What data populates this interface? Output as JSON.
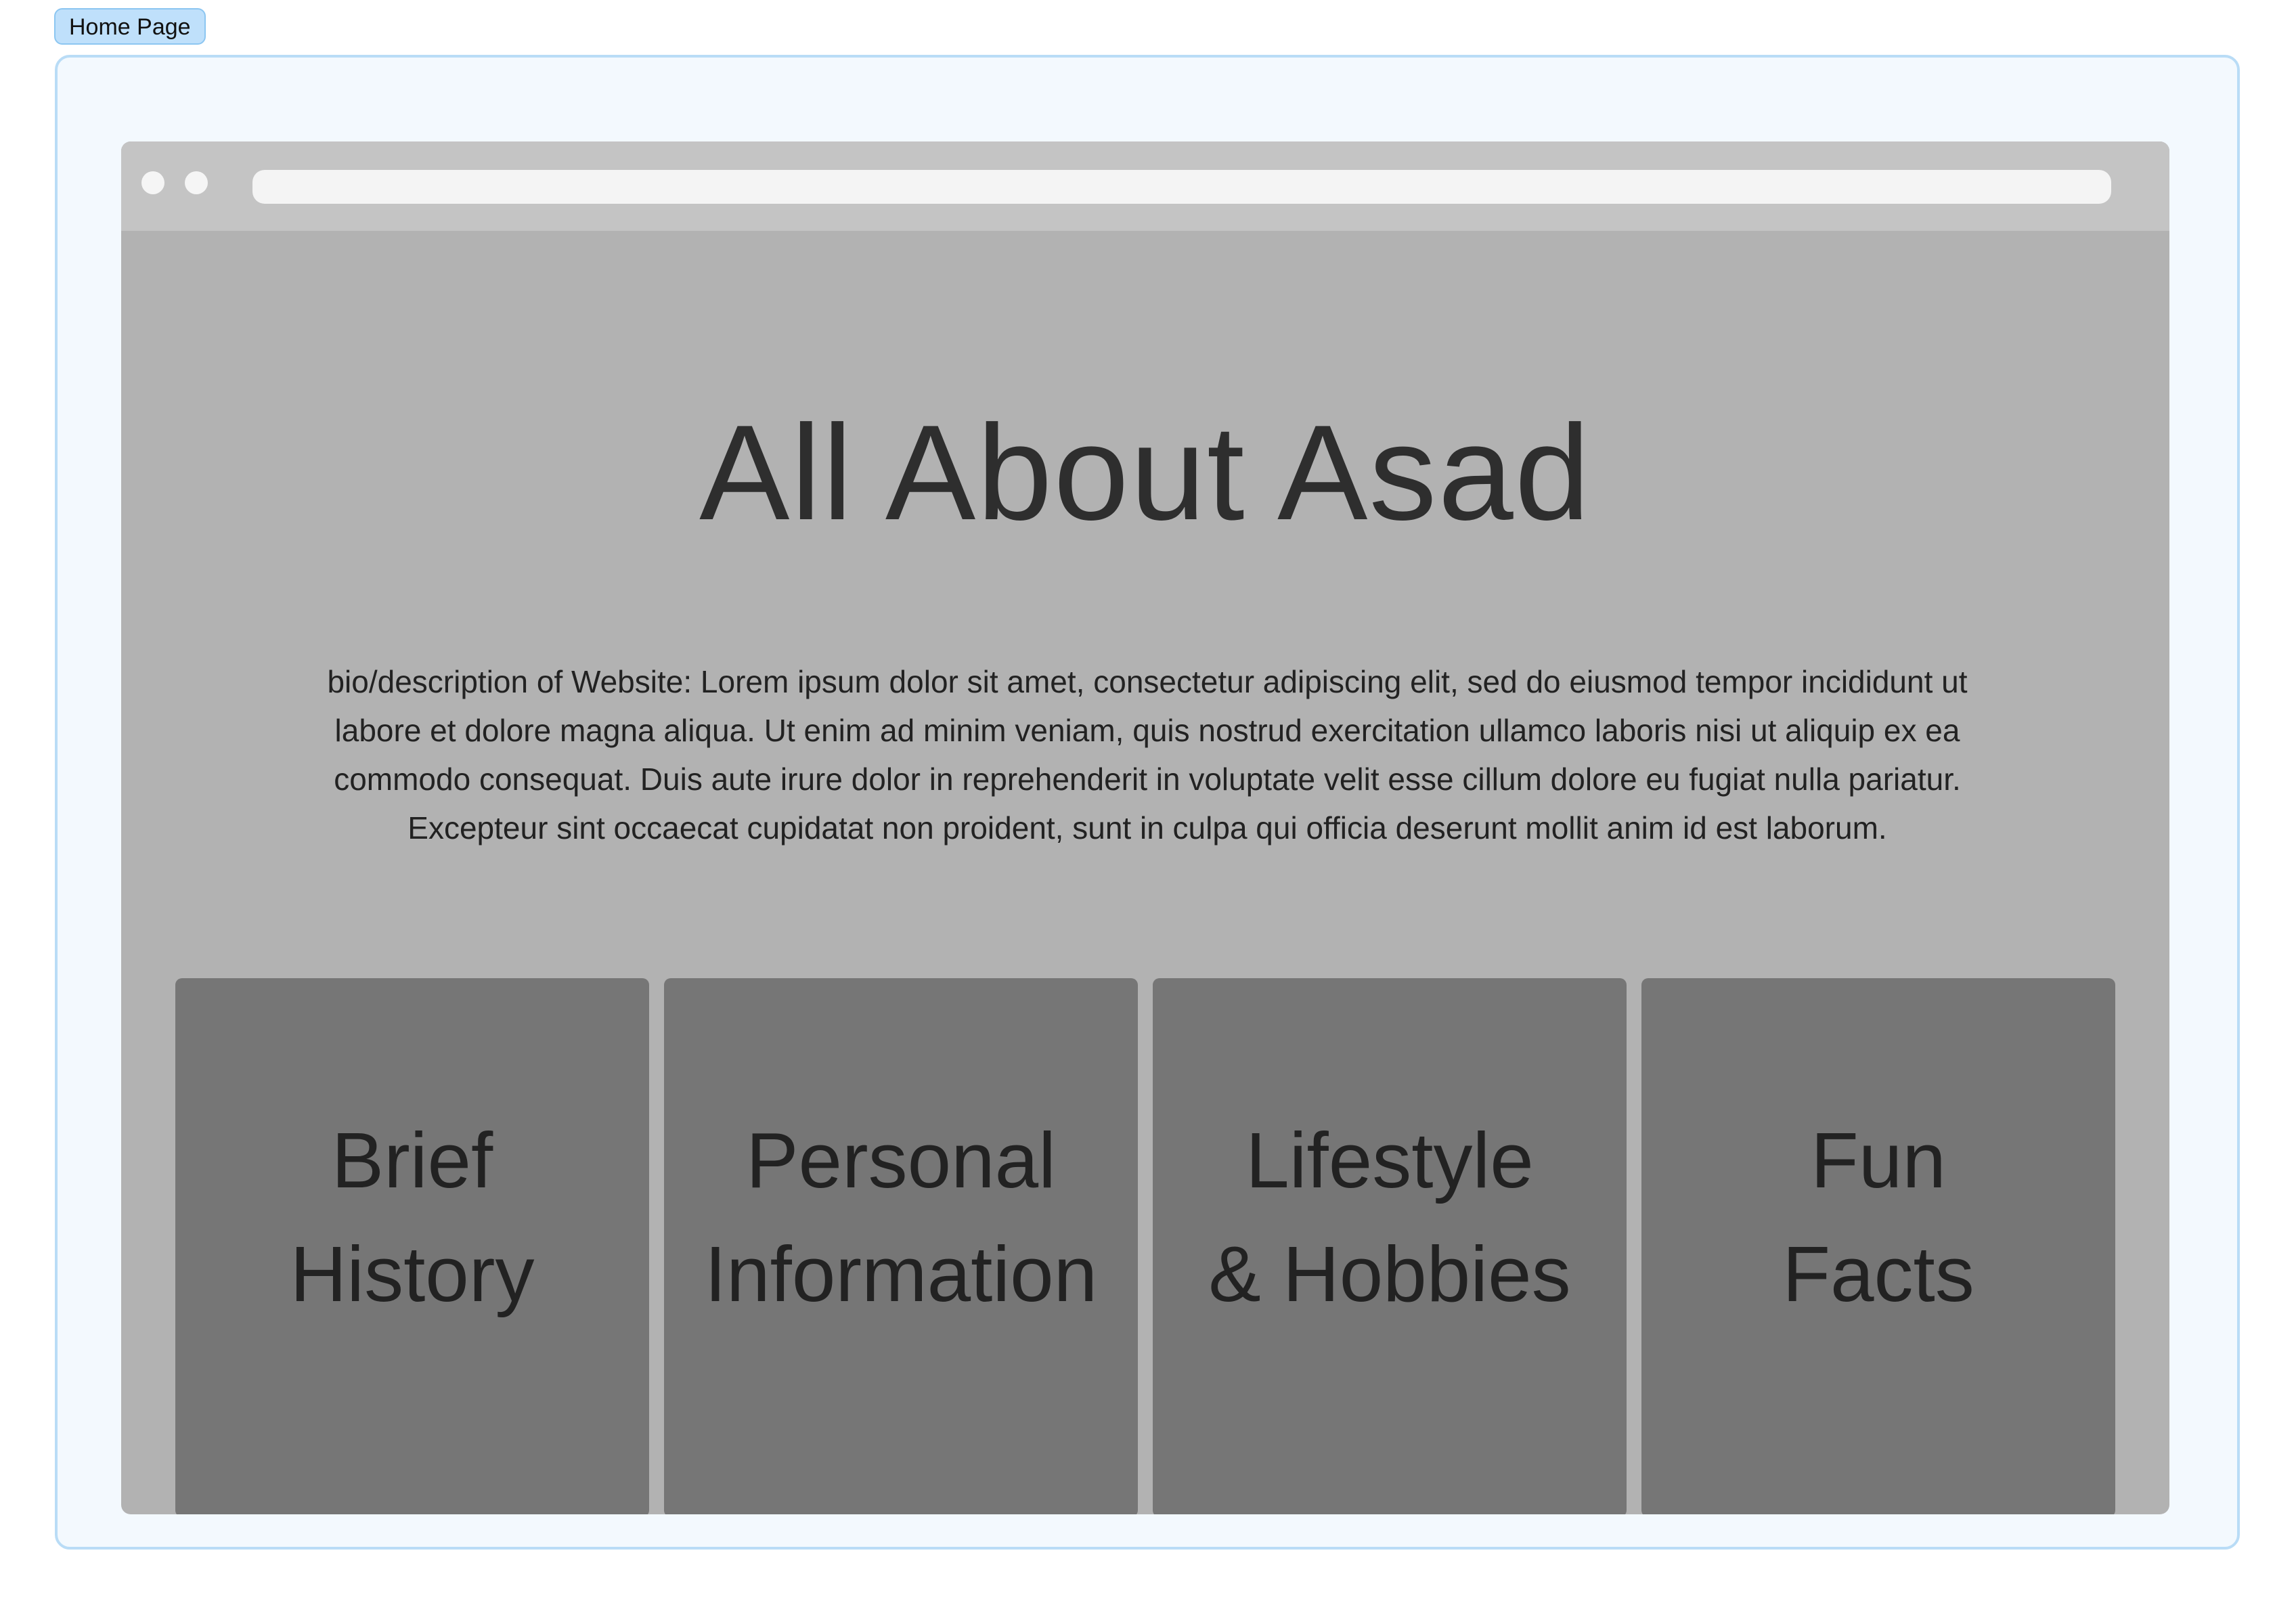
{
  "frame": {
    "label": "Home Page"
  },
  "page": {
    "title": "All About Asad",
    "bio": "bio/description of Website: Lorem ipsum dolor sit amet, consectetur adipiscing elit, sed do eiusmod tempor incididunt ut labore et dolore magna aliqua. Ut enim ad minim veniam, quis nostrud exercitation ullamco laboris nisi ut aliquip ex ea commodo consequat. Duis aute irure dolor in reprehenderit in voluptate velit esse cillum dolore eu fugiat nulla pariatur. Excepteur sint occaecat cupidatat non proident, sunt in culpa qui officia deserunt mollit anim id est laborum."
  },
  "cards": [
    {
      "label": "Brief\nHistory"
    },
    {
      "label": "Personal\nInformation"
    },
    {
      "label": "Lifestyle\n& Hobbies"
    },
    {
      "label": "Fun\nFacts"
    }
  ],
  "colors": {
    "frame_border": "#b9dcf6",
    "frame_background": "#f3f9fe",
    "label_background": "#bfe0fb",
    "browser_background": "#b2b2b2",
    "browser_bar": "#c4c4c4",
    "card_background": "#767676",
    "text": "#2e2e2e"
  }
}
